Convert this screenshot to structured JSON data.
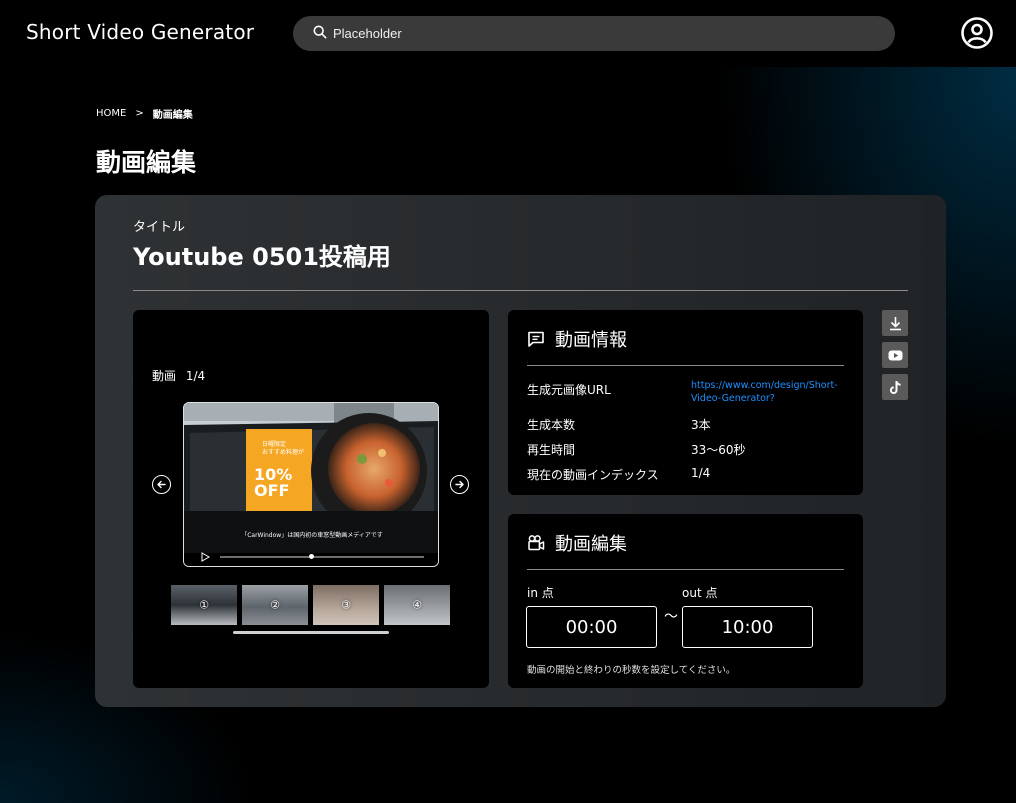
{
  "app": {
    "title": "Short Video Generator"
  },
  "search": {
    "placeholder": "Placeholder"
  },
  "breadcrumb": {
    "home": "HOME",
    "separator": ">",
    "current": "動画編集"
  },
  "page": {
    "title": "動画編集"
  },
  "video": {
    "title_label": "タイトル",
    "title": "Youtube 0501投稿用",
    "counter_label": "動画",
    "counter": "1/4",
    "overlay_badge_top": "日曜限定",
    "overlay_badge_sub": "おすすめ料理が",
    "overlay_discount": "10%",
    "overlay_off": "OFF",
    "overlay_caption": "「CarWindow」は国内初の車窓型動画メディアです",
    "playback_position": 0.45,
    "thumbnails": [
      "①",
      "②",
      "③",
      "④"
    ]
  },
  "info": {
    "heading": "動画情報",
    "rows": [
      {
        "key": "生成元画像URL",
        "value": "https://www.com/design/Short-Video-Generator?"
      },
      {
        "key": "生成本数",
        "value": "3本"
      },
      {
        "key": "再生時間",
        "value": "33〜60秒"
      },
      {
        "key": "現在の動画インデックス",
        "value": "1/4"
      }
    ]
  },
  "edit": {
    "heading": "動画編集",
    "in_label": "in 点",
    "out_label": "out 点",
    "in_value": "00:00",
    "out_value": "10:00",
    "tilde": "〜",
    "hint": "動画の開始と終わりの秒数を設定してください。"
  },
  "colors": {
    "accent_link": "#1e90ff",
    "badge_orange": "#f5a623",
    "panel_bg": "#2b2e30"
  }
}
